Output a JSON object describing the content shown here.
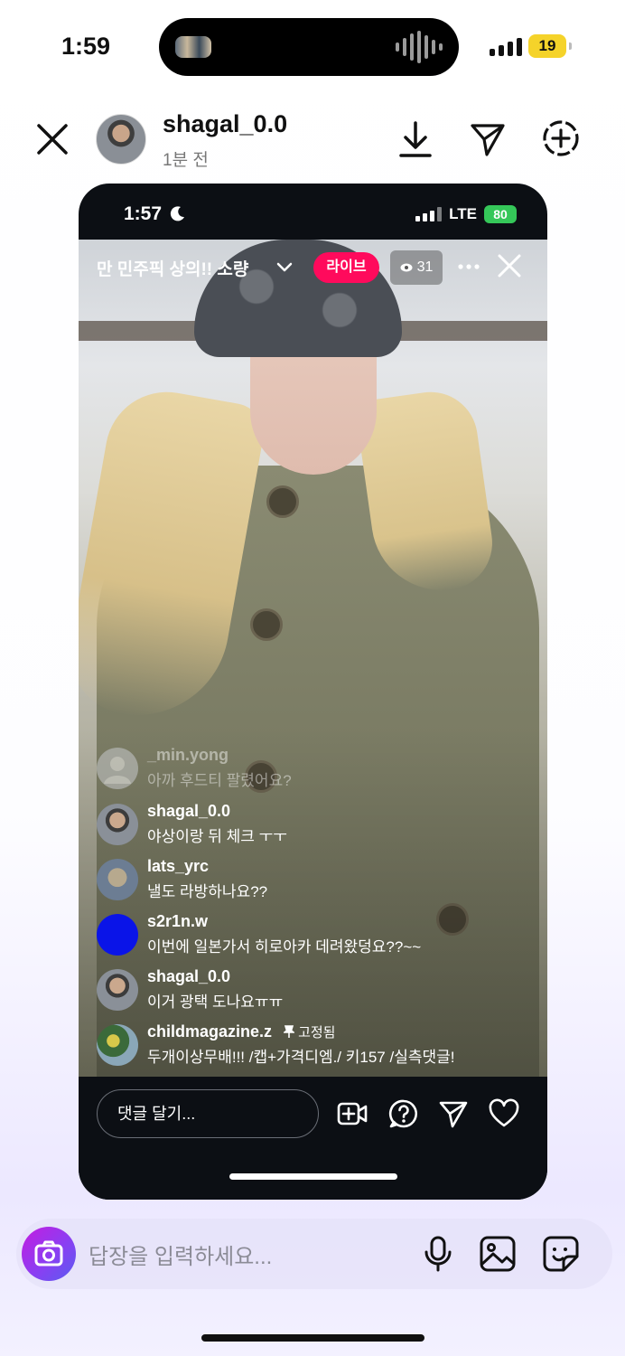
{
  "status_bar": {
    "time": "1:59",
    "battery": "19"
  },
  "story_header": {
    "username": "shagal_0.0",
    "time_ago": "1분 전"
  },
  "inner_phone": {
    "time": "1:57",
    "network": "LTE",
    "battery": "80"
  },
  "live": {
    "title": "만 민주픽 상의!!  소량",
    "badge": "라이브",
    "viewers": "31"
  },
  "comments": [
    {
      "user": "_min.yong",
      "text": "아까 후드티 팔렸어요?",
      "faded": true,
      "avatar": "default-avatar"
    },
    {
      "user": "shagal_0.0",
      "text": "야상이랑 뒤 체크 ㅜㅜ",
      "avatar": "photo-avatar"
    },
    {
      "user": "lats_yrc",
      "text": "낼도 라방하나요??",
      "avatar": "photo-avatar"
    },
    {
      "user": "s2r1n.w",
      "text": "이번에 일본가서 히로아카 데려왔덩요??~~",
      "avatar": "blue-avatar"
    },
    {
      "user": "shagal_0.0",
      "text": "이거 광택 도나요ㅠㅠ",
      "avatar": "photo-avatar"
    },
    {
      "user": "childmagazine.z",
      "pin_label": "고정됨",
      "text": "두개이상무배!!! /캡+가격디엠./ 키157 /실측댓글!",
      "avatar": "photo-avatar"
    }
  ],
  "live_controls": {
    "comment_placeholder": "댓글 달기..."
  },
  "reply": {
    "placeholder": "답장을 입력하세요..."
  },
  "colors": {
    "live_badge": "#ff0a5c",
    "battery_top": "#f5d32a",
    "battery_inner": "#35c759",
    "camera_gradient": [
      "#c41de0",
      "#5a5cf0"
    ]
  }
}
